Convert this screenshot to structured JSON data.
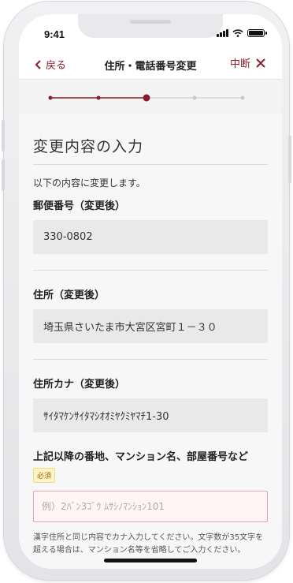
{
  "status_bar": {
    "time": "9:41"
  },
  "navbar": {
    "back_label": "戻る",
    "title": "住所・電話番号変更",
    "abort_label": "中断"
  },
  "progress": {
    "total_steps": 5,
    "current_step": 3
  },
  "colors": {
    "accent": "#8a1d2b",
    "inactive": "#c8c8c8"
  },
  "form": {
    "page_title": "変更内容の入力",
    "intro": "以下の内容に変更します。",
    "postal": {
      "label": "郵便番号（変更後）",
      "value": "330-0802"
    },
    "address": {
      "label": "住所（変更後）",
      "value": "埼玉県さいたま市大宮区宮町１－３０"
    },
    "address_kana": {
      "label": "住所カナ（変更後）",
      "value": "ｻｲﾀﾏｹﾝｻｲﾀﾏｼｵｵﾐﾔｸﾐﾔﾏﾁ1-30"
    },
    "building": {
      "label": "上記以降の番地、マンション名、部屋番号など",
      "required_badge": "必須",
      "placeholder": "例）2ﾊﾞﾝ3ｺﾞｳ ﾑｻｼﾉﾏﾝｼｮﾝ101",
      "help": "漢字住所と同じ内容でカナ入力してください。文字数が35文字を超える場合は、マンション名等を省略してご入力ください。"
    }
  }
}
